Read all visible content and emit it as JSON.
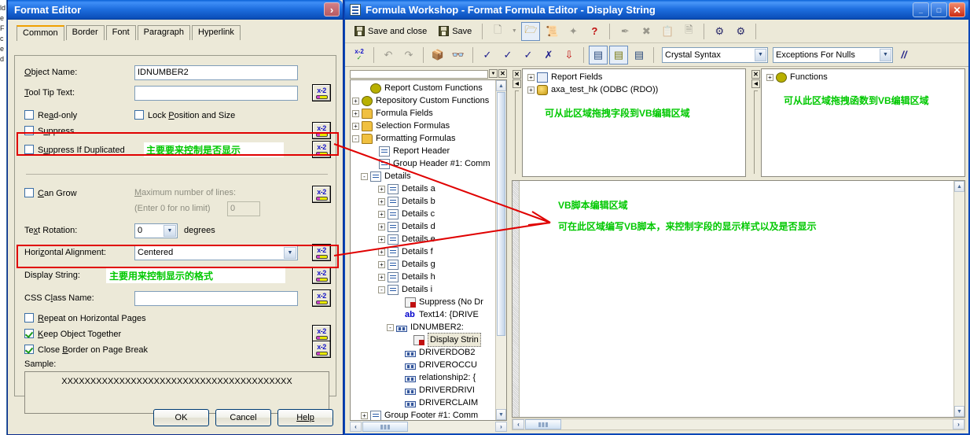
{
  "format_editor": {
    "title": "Format Editor",
    "close_label": "›",
    "tabs": [
      {
        "label": "Common",
        "active": true
      },
      {
        "label": "Border",
        "active": false
      },
      {
        "label": "Font",
        "active": false
      },
      {
        "label": "Paragraph",
        "active": false
      },
      {
        "label": "Hyperlink",
        "active": false
      }
    ],
    "fields": {
      "object_name_label": "Object Name:",
      "object_name_value": "IDNUMBER2",
      "tooltip_label": "Tool Tip Text:",
      "tooltip_value": "",
      "readonly_label": "Read-only",
      "lock_label": "Lock Position and Size",
      "suppress_label": "Suppress",
      "suppress_dup_label": "Suppress If Duplicated",
      "can_grow_label": "Can Grow",
      "max_lines_label": "Maximum number of lines:",
      "max_lines_hint": "(Enter 0 for no limit)",
      "max_lines_value": "0",
      "text_rotation_label": "Text Rotation:",
      "text_rotation_value": "0",
      "degrees_label": "degrees",
      "halign_label": "Horizontal Alignment:",
      "halign_value": "Centered",
      "display_string_label": "Display String:",
      "css_class_label": "CSS Class Name:",
      "css_class_value": "",
      "repeat_label": "Repeat on Horizontal Pages",
      "keep_together_label": "Keep Object Together",
      "close_border_label": "Close Border on Page Break",
      "sample_label": "Sample:",
      "sample_value": "XXXXXXXXXXXXXXXXXXXXXXXXXXXXXXXXXXXXXXXX"
    },
    "annotations": {
      "suppress_note": "主要要来控制是否显示",
      "display_string_note": "主要用来控制显示的格式"
    },
    "buttons": {
      "ok": "OK",
      "cancel": "Cancel",
      "help": "Help"
    },
    "formula_btn_label": "x-2"
  },
  "formula_workshop": {
    "title": "Formula Workshop - Format Formula Editor  - Display String",
    "window_buttons": {
      "minimize": "_",
      "maximize": "□",
      "close": "✕"
    },
    "toolbar": {
      "save_and_close": "Save and close",
      "save": "Save",
      "icons": [
        "new-formula-icon",
        "dropdown-arrow-icon",
        "open-folder-icon",
        "properties-icon",
        "wizard-icon",
        "help-icon",
        "rename-icon",
        "delete-icon",
        "paste-icon",
        "duplicate-icon",
        "custom-function-icon",
        "repository-function-icon"
      ]
    },
    "toolbar2": {
      "icons": [
        "x2-check-icon",
        "undo-icon",
        "redo-icon",
        "browse-data-icon",
        "find-icon",
        "check-icon",
        "sort-asc-icon",
        "sort-desc-icon",
        "comment-icon",
        "sort-az-icon",
        "field-tree-icon",
        "function-tree-icon",
        "operator-tree-icon"
      ],
      "syntax_value": "Crystal Syntax",
      "nulls_value": "Exceptions For Nulls",
      "comment_label": "//"
    },
    "tree": {
      "nodes": [
        {
          "label": "Report Custom Functions",
          "icon": "custom-function-icon",
          "expander": "",
          "indent": 1
        },
        {
          "label": "Repository Custom Functions",
          "icon": "repository-function-icon",
          "expander": "+",
          "indent": 0
        },
        {
          "label": "Formula Fields",
          "icon": "folder-icon",
          "expander": "+",
          "indent": 0
        },
        {
          "label": "Selection Formulas",
          "icon": "folder-icon",
          "expander": "+",
          "indent": 0
        },
        {
          "label": "Formatting Formulas",
          "icon": "folder-icon",
          "expander": "-",
          "indent": 0
        },
        {
          "label": "Report Header",
          "icon": "section-icon",
          "expander": "",
          "indent": 2
        },
        {
          "label": "Group Header #1: Comm",
          "icon": "section-icon",
          "expander": "",
          "indent": 2
        },
        {
          "label": "Details",
          "icon": "section-icon",
          "expander": "-",
          "indent": 1
        },
        {
          "label": "Details a",
          "icon": "section-x-icon",
          "expander": "+",
          "indent": 3
        },
        {
          "label": "Details b",
          "icon": "section-x-icon",
          "expander": "+",
          "indent": 3
        },
        {
          "label": "Details c",
          "icon": "section-x-icon",
          "expander": "+",
          "indent": 3
        },
        {
          "label": "Details d",
          "icon": "section-x-icon",
          "expander": "+",
          "indent": 3
        },
        {
          "label": "Details e",
          "icon": "section-x-icon",
          "expander": "+",
          "indent": 3
        },
        {
          "label": "Details f",
          "icon": "section-x-icon",
          "expander": "+",
          "indent": 3
        },
        {
          "label": "Details g",
          "icon": "section-x-icon",
          "expander": "+",
          "indent": 3
        },
        {
          "label": "Details h",
          "icon": "section-x-icon",
          "expander": "+",
          "indent": 3
        },
        {
          "label": "Details i",
          "icon": "section-x-icon",
          "expander": "-",
          "indent": 3
        },
        {
          "label": "Suppress (No Dr",
          "icon": "formula-icon",
          "expander": "",
          "indent": 5
        },
        {
          "label": "Text14: {DRIVE",
          "icon": "ab-icon",
          "expander": "",
          "indent": 5
        },
        {
          "label": "IDNUMBER2:",
          "icon": "field-icon",
          "expander": "-",
          "indent": 4
        },
        {
          "label": "Display Strin",
          "icon": "formula-icon",
          "expander": "",
          "indent": 6,
          "selected": true
        },
        {
          "label": "DRIVERDOB2",
          "icon": "field-icon",
          "expander": "",
          "indent": 5
        },
        {
          "label": "DRIVEROCCU",
          "icon": "field-icon",
          "expander": "",
          "indent": 5
        },
        {
          "label": "relationship2: {",
          "icon": "field-icon",
          "expander": "",
          "indent": 5
        },
        {
          "label": "DRIVERDRIVI",
          "icon": "field-icon",
          "expander": "",
          "indent": 5
        },
        {
          "label": "DRIVERCLAIM",
          "icon": "field-icon",
          "expander": "",
          "indent": 5
        },
        {
          "label": "Group Footer #1: Comm",
          "icon": "section-icon",
          "expander": "+",
          "indent": 1
        }
      ]
    },
    "report_fields_pane": {
      "nodes": [
        {
          "label": "Report Fields",
          "icon": "report-fields-icon",
          "expander": "+"
        },
        {
          "label": "axa_test_hk (ODBC (RDO))",
          "icon": "database-icon",
          "expander": "+"
        }
      ],
      "note": "可从此区域拖拽字段到VB编辑区域"
    },
    "functions_pane": {
      "nodes": [
        {
          "label": "Functions",
          "icon": "functions-icon",
          "expander": "+"
        }
      ],
      "note": "可从此区域拖拽函数到VB编辑区域"
    },
    "editor_pane": {
      "note_line1": "VB脚本编辑区域",
      "note_line2": "可在此区域编写VB脚本，来控制字段的显示样式以及是否显示"
    }
  },
  "colors": {
    "titlebar_blue": "#0a4fba",
    "annotation_green": "#00c800",
    "highlight_red": "#e00000",
    "dialog_face": "#ece9d8"
  }
}
